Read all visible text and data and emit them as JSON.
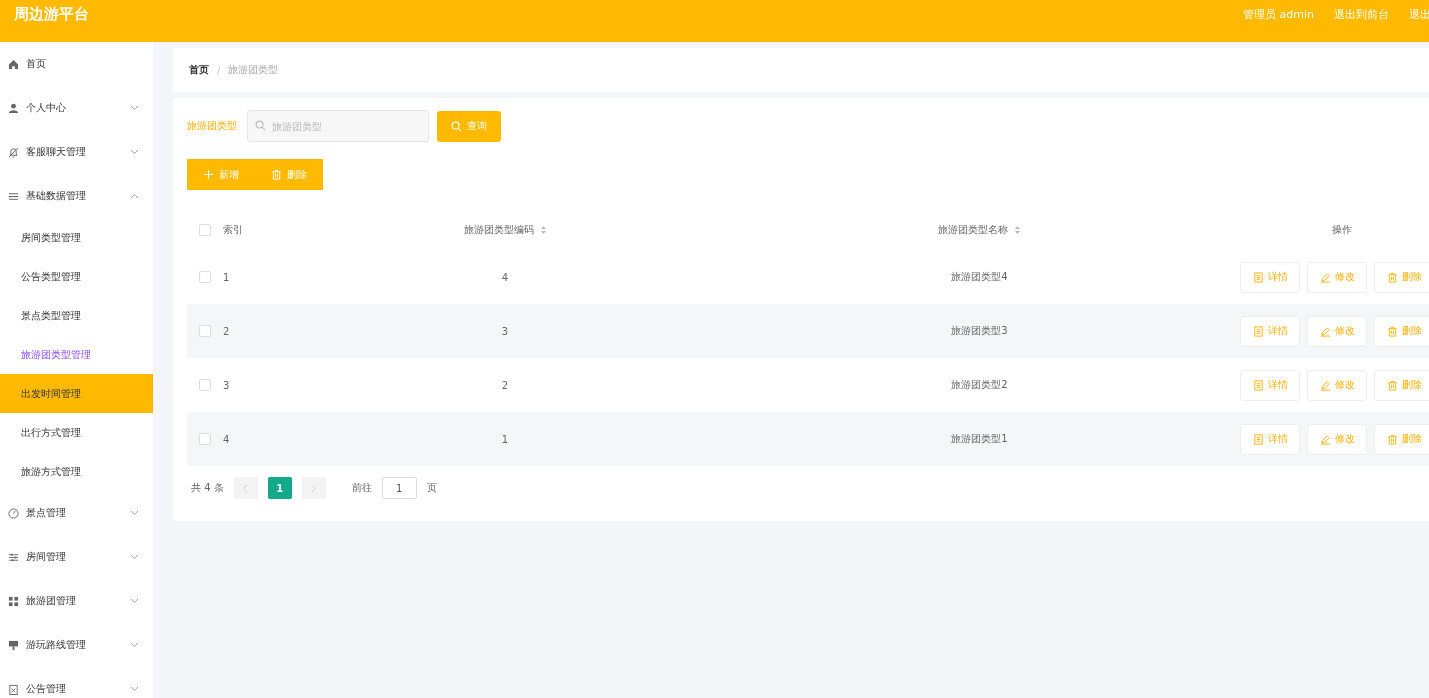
{
  "header": {
    "title": "周边游平台",
    "user": "管理员 admin",
    "links": [
      "退出到前台",
      "退出"
    ]
  },
  "sidebar": {
    "items": [
      {
        "label": "首页"
      },
      {
        "label": "个人中心",
        "expanded": false
      },
      {
        "label": "客服聊天管理",
        "expanded": false
      },
      {
        "label": "基础数据管理",
        "expanded": true,
        "children": [
          {
            "label": "房间类型管理",
            "selected": false,
            "highlighted": false
          },
          {
            "label": "公告类型管理",
            "selected": false,
            "highlighted": false
          },
          {
            "label": "景点类型管理",
            "selected": false,
            "highlighted": false
          },
          {
            "label": "旅游团类型管理",
            "selected": false,
            "highlighted": true
          },
          {
            "label": "出发时间管理",
            "selected": true,
            "highlighted": false
          },
          {
            "label": "出行方式管理",
            "selected": false,
            "highlighted": false
          },
          {
            "label": "旅游方式管理",
            "selected": false,
            "highlighted": false
          }
        ]
      },
      {
        "label": "景点管理",
        "expanded": false
      },
      {
        "label": "房间管理",
        "expanded": false
      },
      {
        "label": "旅游团管理",
        "expanded": false
      },
      {
        "label": "游玩路线管理",
        "expanded": false
      },
      {
        "label": "公告管理",
        "expanded": false
      }
    ]
  },
  "breadcrumb": {
    "items": [
      "首页",
      "旅游团类型"
    ],
    "separator": "/"
  },
  "search": {
    "label": "旅游团类型",
    "placeholder": "旅游团类型",
    "button": "查询"
  },
  "actions": [
    {
      "label": "新增",
      "kind": "add"
    },
    {
      "label": "删除",
      "kind": "delete"
    }
  ],
  "table": {
    "all_checked": false,
    "columns": [
      {
        "label": "索引",
        "sortable": false
      },
      {
        "label": "旅游团类型编码",
        "sortable": true
      },
      {
        "label": "旅游团类型名称",
        "sortable": true
      },
      {
        "label": "操作",
        "sortable": false
      }
    ],
    "rows": [
      {
        "cells": [
          "1",
          "4",
          "旅游团类型4"
        ],
        "checked": false,
        "actions": [
          {
            "label": "详情",
            "kind": "details"
          },
          {
            "label": "修改",
            "kind": "edit"
          },
          {
            "label": "删除",
            "kind": "delete"
          }
        ]
      },
      {
        "cells": [
          "2",
          "3",
          "旅游团类型3"
        ],
        "checked": false,
        "actions": [
          {
            "label": "详情",
            "kind": "details"
          },
          {
            "label": "修改",
            "kind": "edit"
          },
          {
            "label": "删除",
            "kind": "delete"
          }
        ]
      },
      {
        "cells": [
          "3",
          "2",
          "旅游团类型2"
        ],
        "checked": false,
        "actions": [
          {
            "label": "详情",
            "kind": "details"
          },
          {
            "label": "修改",
            "kind": "edit"
          },
          {
            "label": "删除",
            "kind": "delete"
          }
        ]
      },
      {
        "cells": [
          "4",
          "1",
          "旅游团类型1"
        ],
        "checked": false,
        "actions": [
          {
            "label": "详情",
            "kind": "details"
          },
          {
            "label": "修改",
            "kind": "edit"
          },
          {
            "label": "删除",
            "kind": "delete"
          }
        ]
      }
    ]
  },
  "pagination": {
    "total": "共 4 条",
    "pages": [
      {
        "label": "1",
        "selected": true
      }
    ],
    "goto_label": "前往",
    "goto_value": "1",
    "goto_unit": "页"
  }
}
